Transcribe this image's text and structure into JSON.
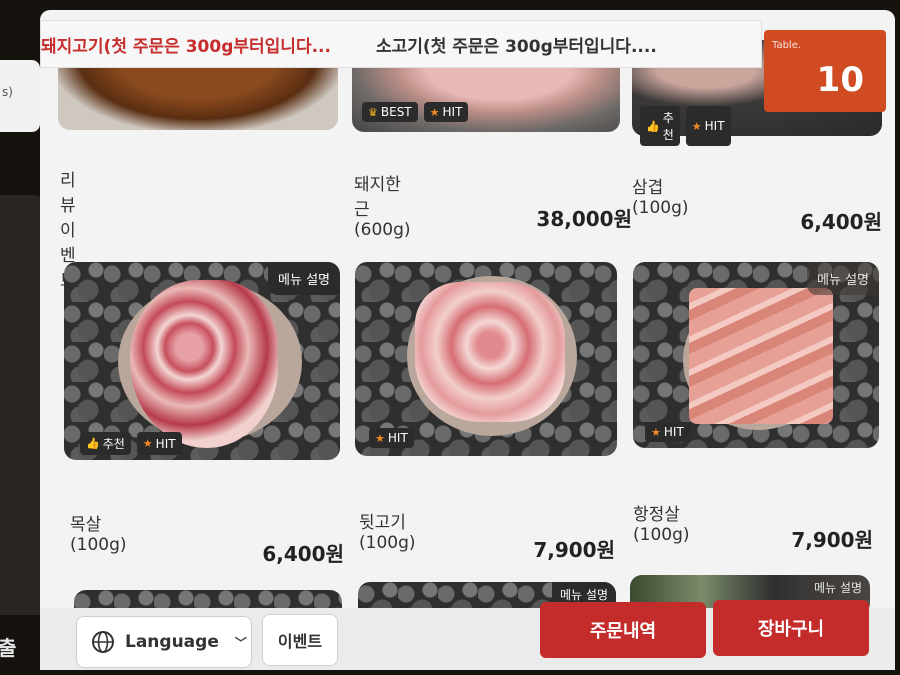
{
  "notice": {
    "pork_notice": "돼지고기(첫 주문은 300g부터입니다...",
    "beef_notice": "소고기(첫 주문은 300g부터입니다...."
  },
  "table": {
    "label": "Table.",
    "number": "10"
  },
  "left_panel": {
    "tab_fragment": "s)",
    "exit_label": "출"
  },
  "menu": [
    {
      "name": "리뷰이벤트",
      "price": "",
      "chips": [],
      "desc_tag": ""
    },
    {
      "name": "돼지한근(600g)",
      "price": "38,000원",
      "chips": [
        {
          "icon": "crown-icon",
          "label": "BEST"
        },
        {
          "icon": "star-icon",
          "label": "HIT"
        }
      ],
      "desc_tag": ""
    },
    {
      "name": "삼겹(100g)",
      "price": "6,400원",
      "chips": [
        {
          "icon": "thumbs-up-icon",
          "label": "추천"
        },
        {
          "icon": "star-icon",
          "label": "HIT"
        }
      ],
      "desc_tag": ""
    },
    {
      "name": "목살(100g)",
      "price": "6,400원",
      "chips": [
        {
          "icon": "thumbs-up-icon",
          "label": "추천"
        },
        {
          "icon": "star-icon",
          "label": "HIT"
        }
      ],
      "desc_tag": "메뉴 설명"
    },
    {
      "name": "뒷고기(100g)",
      "price": "7,900원",
      "chips": [
        {
          "icon": "star-icon",
          "label": "HIT"
        }
      ],
      "desc_tag": ""
    },
    {
      "name": "항정살(100g)",
      "price": "7,900원",
      "chips": [
        {
          "icon": "star-icon",
          "label": "HIT"
        }
      ],
      "desc_tag": "메뉴 설명"
    },
    {
      "desc_tag": "메뉴 설명"
    },
    {
      "desc_tag": "메뉴 설명"
    }
  ],
  "bottom": {
    "language_label": "Language",
    "event_label": "이벤트",
    "order_history_label": "주문내역",
    "cart_label": "장바구니"
  },
  "colors": {
    "accent": "#c42b2b",
    "table_badge": "#d04a22",
    "star": "#f08a24"
  }
}
